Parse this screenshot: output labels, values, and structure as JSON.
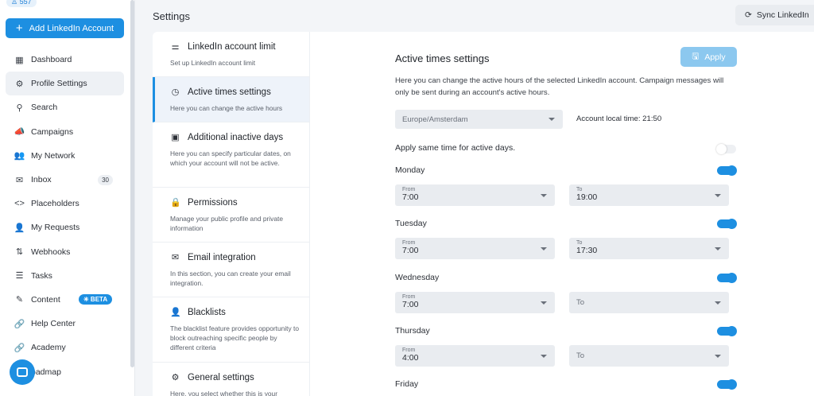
{
  "sidebar": {
    "count_badge": "557",
    "add_button": "Add LinkedIn Account",
    "items": [
      {
        "label": "Dashboard",
        "icon": "dashboard-icon",
        "glyph": "▦"
      },
      {
        "label": "Profile Settings",
        "icon": "gear-icon",
        "glyph": "⚙"
      },
      {
        "label": "Search",
        "icon": "search-icon",
        "glyph": "⚲"
      },
      {
        "label": "Campaigns",
        "icon": "megaphone-icon",
        "glyph": "📣"
      },
      {
        "label": "My Network",
        "icon": "users-icon",
        "glyph": "👥"
      },
      {
        "label": "Inbox",
        "icon": "mail-icon",
        "glyph": "✉",
        "badge": "30"
      },
      {
        "label": "Placeholders",
        "icon": "code-icon",
        "glyph": "<>"
      },
      {
        "label": "My Requests",
        "icon": "user-request-icon",
        "glyph": "👤"
      },
      {
        "label": "Webhooks",
        "icon": "arrows-updown-icon",
        "glyph": "⇅"
      },
      {
        "label": "Tasks",
        "icon": "list-icon",
        "glyph": "☰"
      },
      {
        "label": "Content",
        "icon": "content-icon",
        "glyph": "✎",
        "beta": "✳ BETA"
      },
      {
        "label": "Help Center",
        "icon": "link-icon",
        "glyph": "🔗"
      },
      {
        "label": "Academy",
        "icon": "link-icon",
        "glyph": "🔗"
      },
      {
        "label": "oadmap",
        "icon": "roadmap-icon",
        "glyph": "◷"
      }
    ]
  },
  "header": {
    "title": "Settings",
    "sync_button": "Sync LinkedIn"
  },
  "settings_menu": [
    {
      "title": "LinkedIn account limit",
      "desc": "Set up LinkedIn account limit",
      "icon": "sliders-icon",
      "glyph": "⚌"
    },
    {
      "title": "Active times settings",
      "desc": "Here you can change the active hours",
      "icon": "clock-icon",
      "glyph": "◷"
    },
    {
      "title": "Additional inactive days",
      "desc": "Here you can specify particular dates, on which your account will not be active.",
      "icon": "calendar-icon",
      "glyph": "▣"
    },
    {
      "title": "Permissions",
      "desc": "Manage your public profile and private information",
      "icon": "lock-icon",
      "glyph": "🔒"
    },
    {
      "title": "Email integration",
      "desc": "In this section, you can create your email integration.",
      "icon": "envelope-icon",
      "glyph": "✉"
    },
    {
      "title": "Blacklists",
      "desc": "The blacklist feature provides opportunity to block outreaching specific people by different criteria",
      "icon": "user-block-icon",
      "glyph": "👤"
    },
    {
      "title": "General settings",
      "desc": "Here, you select whether this is your",
      "icon": "gear-icon",
      "glyph": "⚙"
    }
  ],
  "active_times": {
    "title": "Active times settings",
    "apply_label": "Apply",
    "description": "Here you can change the active hours of the selected LinkedIn account. Campaign messages will only be sent during an account's active hours.",
    "timezone": "Europe/Amsterdam",
    "local_time": "Account local time: 21:50",
    "same_time_label": "Apply same time for active days.",
    "from_label": "From",
    "to_label": "To",
    "days": [
      {
        "name": "Monday",
        "from": "7:00",
        "to": "19:00"
      },
      {
        "name": "Tuesday",
        "from": "7:00",
        "to": "17:30"
      },
      {
        "name": "Wednesday",
        "from": "7:00",
        "to": ""
      },
      {
        "name": "Thursday",
        "from": "4:00",
        "to": ""
      },
      {
        "name": "Friday",
        "from": "",
        "to": ""
      }
    ]
  },
  "colors": {
    "accent": "#1d8fe1",
    "apply_disabled": "#8cc8ef",
    "field_bg": "#e9ecf0"
  }
}
